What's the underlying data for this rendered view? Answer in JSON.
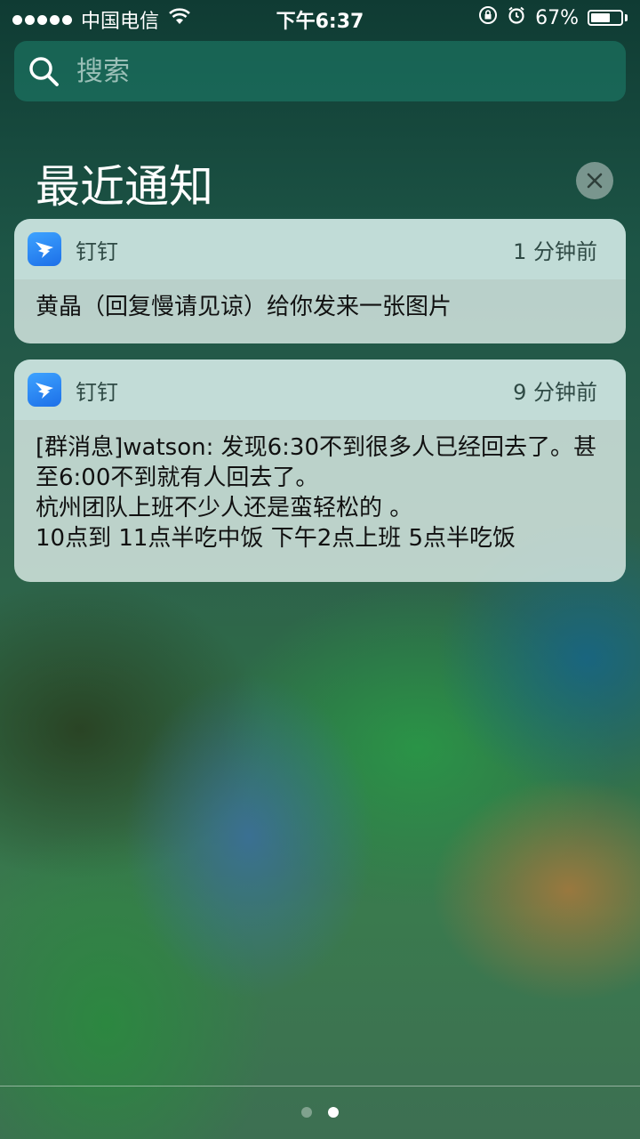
{
  "status_bar": {
    "carrier": "中国电信",
    "time": "下午6:37",
    "battery_percent": "67%",
    "battery_level": 0.67,
    "icons": [
      "signal-dots-icon",
      "wifi-icon",
      "rotation-lock-icon",
      "alarm-icon",
      "battery-icon"
    ]
  },
  "search": {
    "placeholder": "搜索"
  },
  "notifications_section": {
    "title": "最近通知"
  },
  "notifications": [
    {
      "app": "钉钉",
      "time": "1 分钟前",
      "message": "黄晶（回复慢请见谅）给你发来一张图片"
    },
    {
      "app": "钉钉",
      "time": "9 分钟前",
      "message": "[群消息]watson: 发现6:30不到很多人已经回去了。甚至6:00不到就有人回去了。\n杭州团队上班不少人还是蛮轻松的 。\n10点到 11点半吃中饭  下午2点上班   5点半吃饭"
    }
  ],
  "page_indicator": {
    "total": 2,
    "current": 2
  }
}
